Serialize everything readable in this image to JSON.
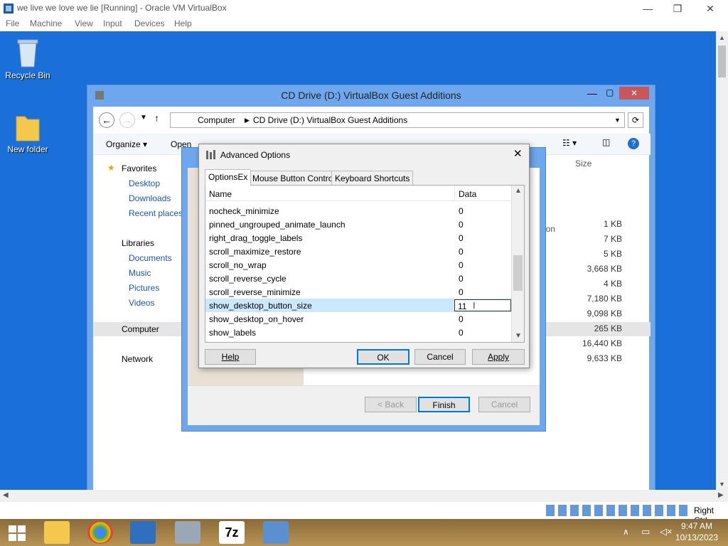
{
  "host": {
    "title": "we live we love we lie [Running] - Oracle VM VirtualBox",
    "menu": [
      "File",
      "Machine",
      "View",
      "Input",
      "Devices",
      "Help"
    ],
    "host_key": "Right Ctrl"
  },
  "desktop": {
    "icons": [
      {
        "label": "Recycle Bin"
      },
      {
        "label": "New folder"
      }
    ]
  },
  "explorer": {
    "title": "CD Drive (D:) VirtualBox Guest Additions",
    "address": {
      "crumb1": "Computer",
      "crumb2": "CD Drive (D:) VirtualBox Guest Additions"
    },
    "toolbar": {
      "organize": "Organize ▾",
      "open": "Open"
    },
    "nav": {
      "favorites": "Favorites",
      "desktop": "Desktop",
      "downloads": "Downloads",
      "recent": "Recent places",
      "libraries": "Libraries",
      "documents": "Documents",
      "music": "Music",
      "pictures": "Pictures",
      "videos": "Videos",
      "computer": "Computer",
      "network": "Network"
    },
    "size_header": "Size",
    "fragment": "ion",
    "sizes": [
      "1 KB",
      "7 KB",
      "5 KB",
      "3,668 KB",
      "4 KB",
      "7,180 KB",
      "9,098 KB",
      "265 KB",
      "16,440 KB",
      "9,633 KB"
    ]
  },
  "wizard": {
    "back": "< Back",
    "finish": "Finish",
    "cancel": "Cancel"
  },
  "dialog": {
    "title": "Advanced Options",
    "tabs": [
      "OptionsEx",
      "Mouse Button Control",
      "Keyboard Shortcuts"
    ],
    "columns": {
      "name": "Name",
      "data": "Data"
    },
    "rows": [
      {
        "name": "nocheck_minimize",
        "data": "0"
      },
      {
        "name": "pinned_ungrouped_animate_launch",
        "data": "0"
      },
      {
        "name": "right_drag_toggle_labels",
        "data": "0"
      },
      {
        "name": "scroll_maximize_restore",
        "data": "0"
      },
      {
        "name": "scroll_no_wrap",
        "data": "0"
      },
      {
        "name": "scroll_reverse_cycle",
        "data": "0"
      },
      {
        "name": "scroll_reverse_minimize",
        "data": "0"
      },
      {
        "name": "show_desktop_button_size",
        "data": "11"
      },
      {
        "name": "show_desktop_on_hover",
        "data": "0"
      },
      {
        "name": "show_labels",
        "data": "0"
      }
    ],
    "buttons": {
      "help": "Help",
      "ok": "OK",
      "cancel": "Cancel",
      "apply": "Apply"
    }
  },
  "taskbar": {
    "time": "9:47 AM",
    "date": "10/13/2023"
  }
}
